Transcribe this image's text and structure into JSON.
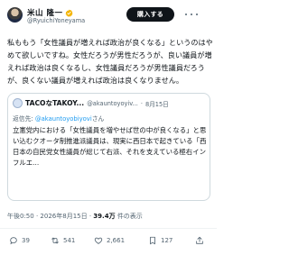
{
  "post": {
    "author_name": "米山 隆一",
    "author_handle": "@RyuichiYoneyama",
    "follow_label": "購入する",
    "text": "私ももう「女性議員が増えれば政治が良くなる」というのはやめて欲しいですね。女性だろうが男性だろうが、良い議員が増えれば政治は良くなるし、女性議員だろうが男性議員だろうが、良くない議員が増えれば政治は良くなりません。",
    "timestamp": "午後0:50",
    "date": "2026年8月15日",
    "views_count": "39.4万",
    "views_label": "件の表示"
  },
  "quote": {
    "name": "TACOなTAKOY...",
    "handle": "@akauntoyoyiv...",
    "date": "8月15日",
    "reply_prefix": "返信先: ",
    "reply_handle": "@akauntoyobiyovi",
    "reply_suffix": "さん",
    "text": "立憲党内における「女性議員を増やせば世の中が良くなる」と思い込むクオータ制推進派議員は、現実に西日本で起きている「西日本の自民党女性議員が総じて右派、それを支えている極右インフルエ..."
  },
  "actions": {
    "replies": "39",
    "reposts": "541",
    "likes": "2,661",
    "bookmarks": "127"
  },
  "colors": {
    "accent": "#1d9bf0",
    "verified": "#f4b400",
    "text": "#0f1419",
    "muted": "#536471"
  },
  "icons": [
    "verified-badge-icon",
    "more-icon",
    "reply-icon",
    "repost-icon",
    "like-icon",
    "bookmark-icon",
    "share-icon"
  ]
}
